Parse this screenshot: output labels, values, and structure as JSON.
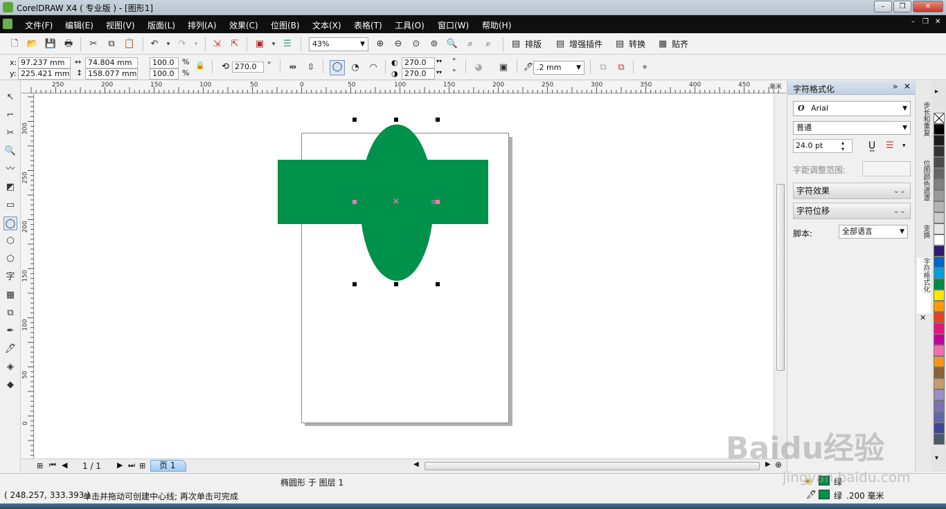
{
  "window": {
    "title": "CorelDRAW X4 ( 专业版 ) - [图形1]"
  },
  "menu": [
    "文件(F)",
    "编辑(E)",
    "视图(V)",
    "版面(L)",
    "排列(A)",
    "效果(C)",
    "位图(B)",
    "文本(X)",
    "表格(T)",
    "工具(O)",
    "窗口(W)",
    "帮助(H)"
  ],
  "toolbar": {
    "zoom": "43%",
    "text_buttons": [
      "排版",
      "增强插件",
      "转换",
      "贴齐"
    ]
  },
  "property_bar": {
    "x_label": "x:",
    "x_value": "97.237 mm",
    "y_label": "y:",
    "y_value": "225.421 mm",
    "width_value": "74.804 mm",
    "height_value": "158.077 mm",
    "scale_x": "100.0",
    "scale_y": "100.0",
    "percent": "%",
    "rotation": "270.0",
    "degree": "°",
    "start_angle": "270.0",
    "end_angle": "270.0",
    "outline_width": ".2 mm"
  },
  "rulers": {
    "h_labels": [
      "250",
      "200",
      "150",
      "100",
      "50",
      "0",
      "50",
      "100",
      "150",
      "200",
      "250",
      "300",
      "350",
      "400",
      "450"
    ],
    "h_unit": "毫米",
    "v_labels": [
      "300",
      "250",
      "200",
      "150",
      "100",
      "50",
      "0"
    ]
  },
  "page_nav": {
    "page_count": "1 / 1",
    "page_tab": "页 1"
  },
  "docker": {
    "title": "字符格式化",
    "font": "Arial",
    "style": "普通",
    "size": "24.0 pt",
    "kerning_label": "字距调整范围:",
    "section_effects": "字符效果",
    "section_shift": "字符位移",
    "script_label": "脚本:",
    "script_value": "全部语言"
  },
  "side_tabs": [
    "步长和重复",
    "位图颜色遮罩",
    "变换",
    "字符格式化"
  ],
  "palette": [
    "#ffffff",
    "#000000",
    "#1a1a1a",
    "#333333",
    "#4d4d4d",
    "#666666",
    "#808080",
    "#999999",
    "#b3b3b3",
    "#cccccc",
    "#e6e6e6",
    "#ffffff",
    "#2e1a6e",
    "#0066cc",
    "#00a0e0",
    "#008a45",
    "#ffe600",
    "#ff9900",
    "#e8431e",
    "#e6147d",
    "#c8009b",
    "#f06eaa",
    "#f7941d",
    "#8c6239",
    "#c69c6d",
    "#9b8ec4",
    "#7b72b6",
    "#5e6aa8",
    "#3b4994",
    "#4b5a6a"
  ],
  "status": {
    "object_info": "椭圆形 于 图层 1",
    "coords": "( 248.257, 333.393 )",
    "hint": "单击并拖动可创建中心线; 再次单击可完成",
    "fill_label": "绿",
    "outline_label": "绿",
    "outline_width": ".200 毫米",
    "fill_color": "#00914a"
  },
  "drawing": {
    "shape_color": "#00914a"
  },
  "watermark": {
    "brand": "Baidu经验",
    "url": "jingyan.baidu.com"
  }
}
